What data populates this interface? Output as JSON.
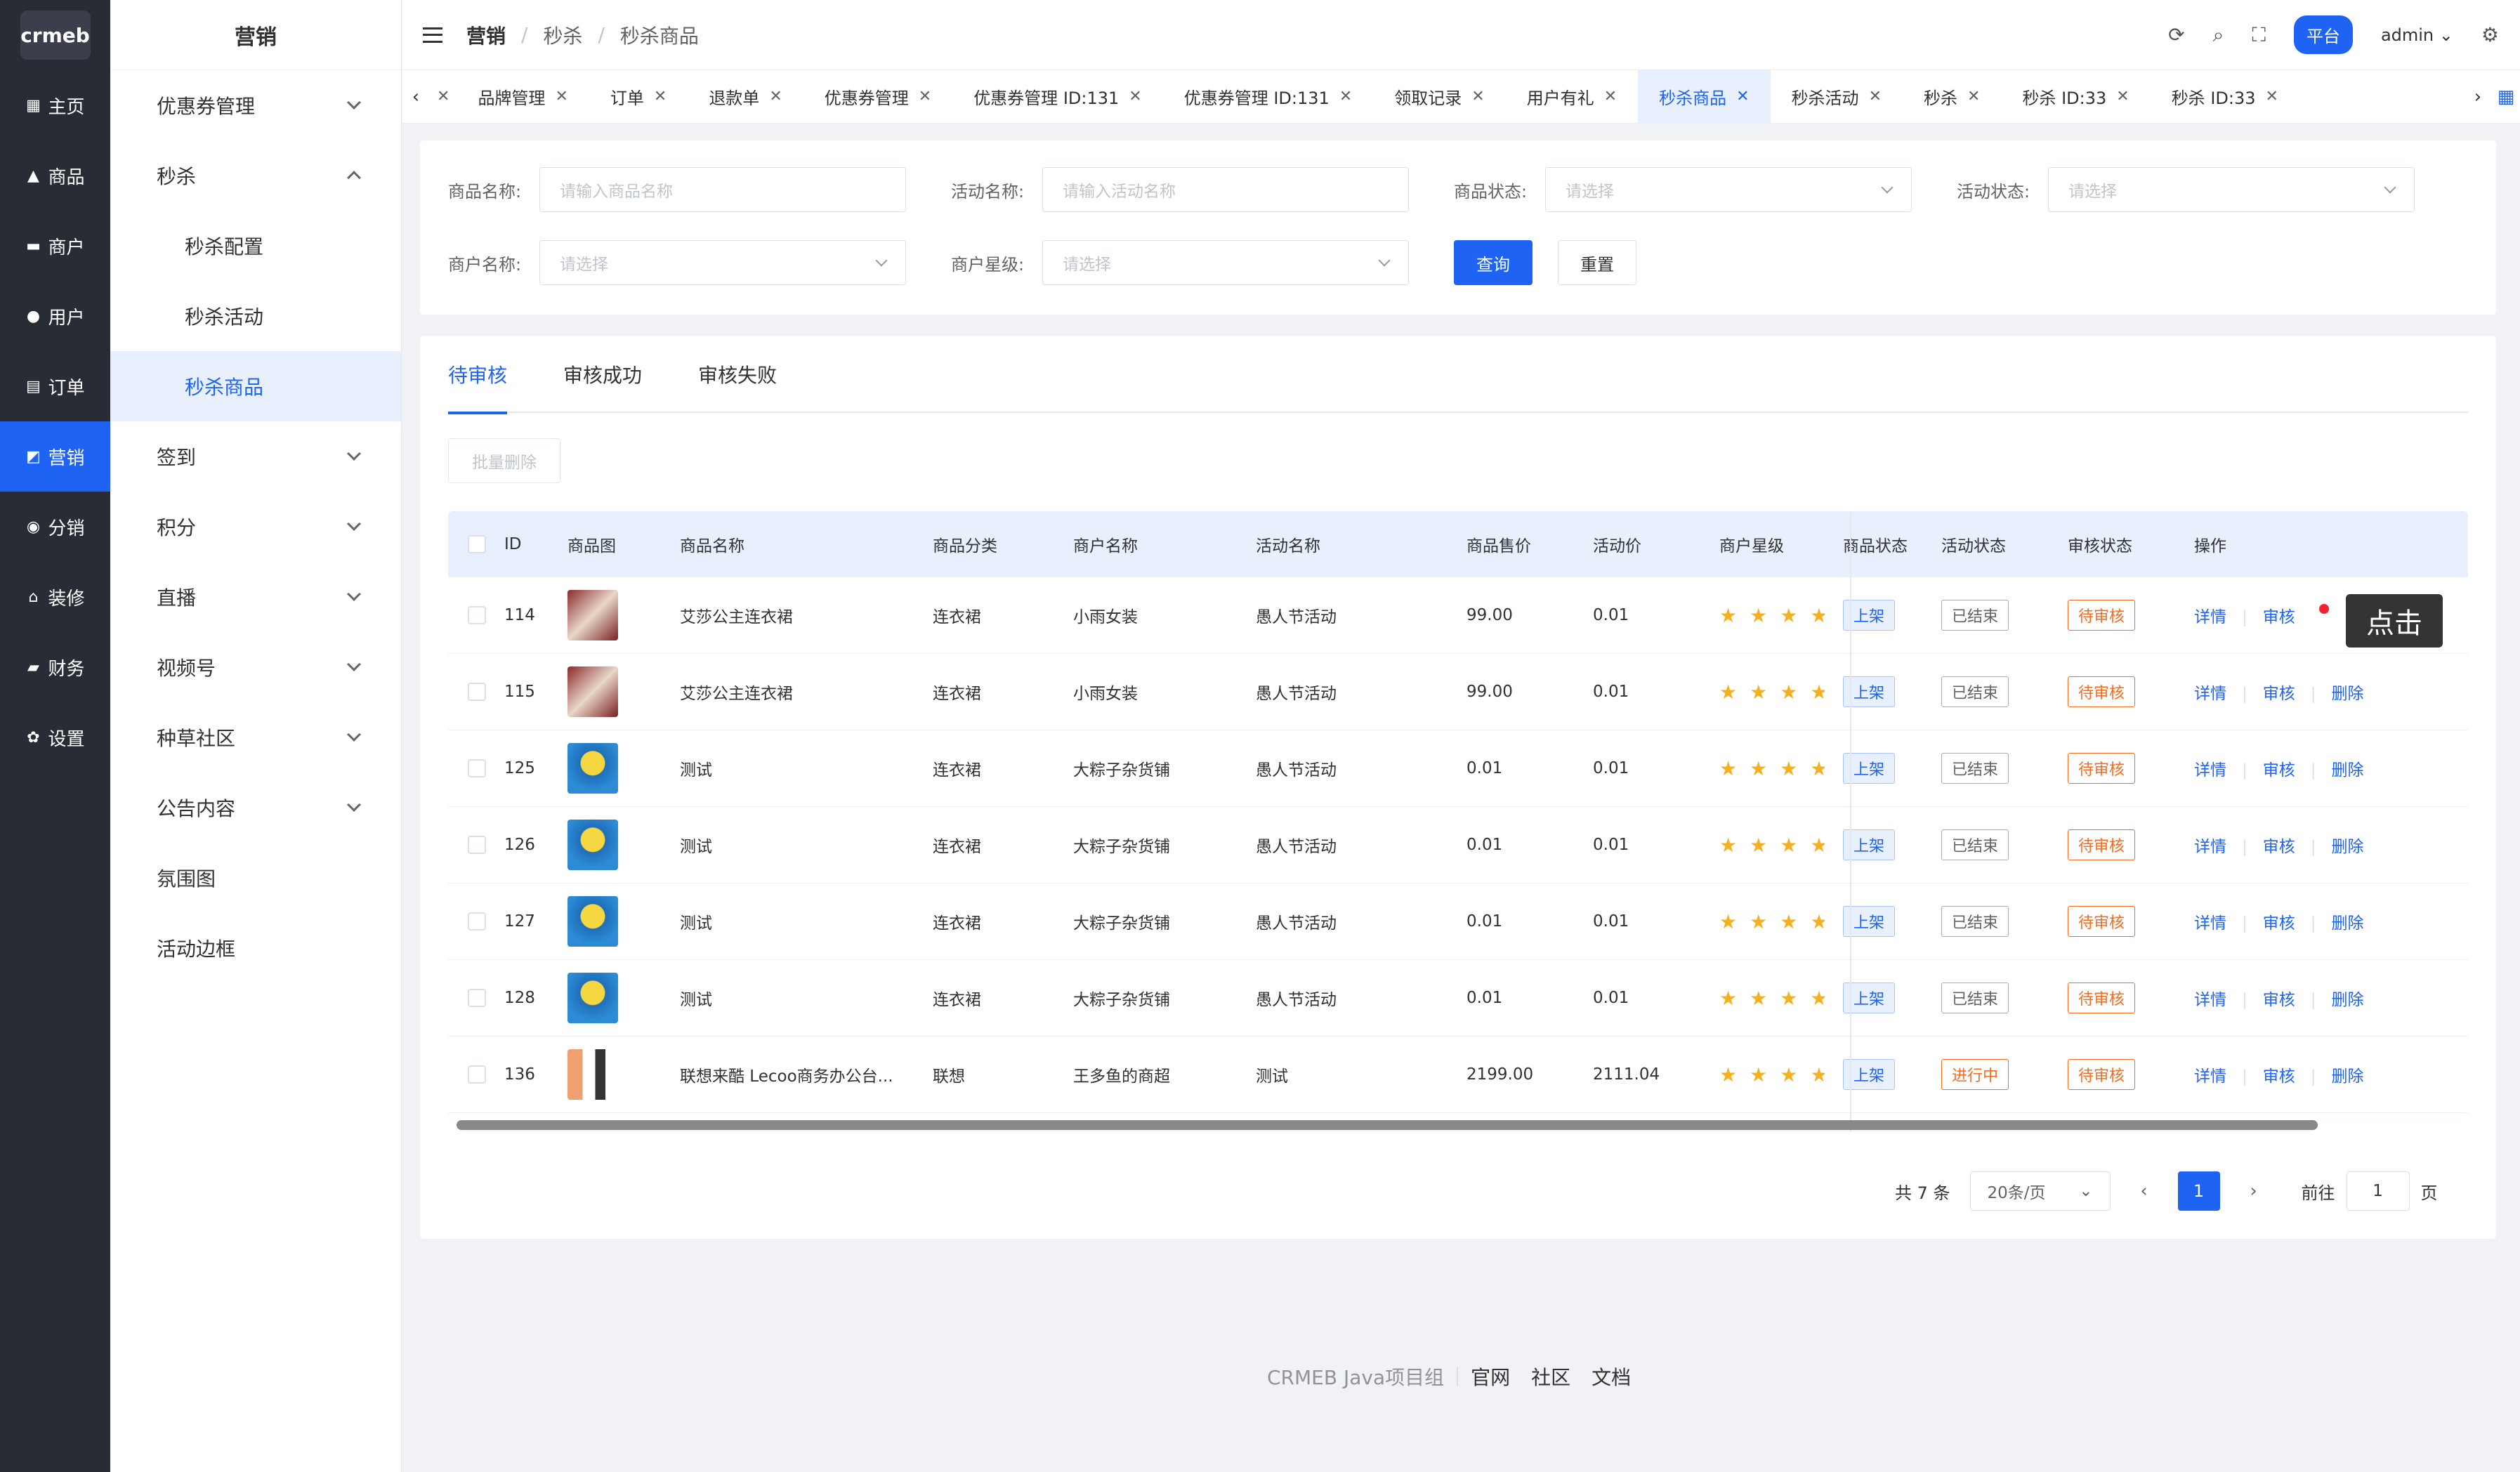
{
  "logo": "crmeb",
  "rail": [
    {
      "label": "主页",
      "icon": "grid-icon"
    },
    {
      "label": "商品",
      "icon": "bag-icon"
    },
    {
      "label": "商户",
      "icon": "store-icon"
    },
    {
      "label": "用户",
      "icon": "user-icon"
    },
    {
      "label": "订单",
      "icon": "order-icon"
    },
    {
      "label": "营销",
      "icon": "marketing-icon"
    },
    {
      "label": "分销",
      "icon": "distribution-icon"
    },
    {
      "label": "装修",
      "icon": "home-icon"
    },
    {
      "label": "财务",
      "icon": "wallet-icon"
    },
    {
      "label": "设置",
      "icon": "gear-icon"
    }
  ],
  "submenu": {
    "title": "营销",
    "items": [
      {
        "label": "优惠券管理"
      },
      {
        "label": "秒杀"
      },
      {
        "label": "秒杀配置"
      },
      {
        "label": "秒杀活动"
      },
      {
        "label": "秒杀商品"
      },
      {
        "label": "签到"
      },
      {
        "label": "积分"
      },
      {
        "label": "直播"
      },
      {
        "label": "视频号"
      },
      {
        "label": "种草社区"
      },
      {
        "label": "公告内容"
      },
      {
        "label": "氛围图"
      },
      {
        "label": "活动边框"
      }
    ]
  },
  "header": {
    "crumbs": [
      "营销",
      "秒杀",
      "秒杀商品"
    ],
    "platform": "平台",
    "user": "admin"
  },
  "tabs": [
    "品牌管理",
    "订单",
    "退款单",
    "优惠券管理",
    "优惠券管理 ID:131",
    "优惠券管理 ID:131",
    "领取记录",
    "用户有礼",
    "秒杀商品",
    "秒杀活动",
    "秒杀",
    "秒杀 ID:33",
    "秒杀 ID:33"
  ],
  "filter": {
    "product_name_label": "商品名称:",
    "product_name_ph": "请输入商品名称",
    "activity_name_label": "活动名称:",
    "activity_name_ph": "请输入活动名称",
    "product_status_label": "商品状态:",
    "activity_status_label": "活动状态:",
    "merchant_name_label": "商户名称:",
    "merchant_star_label": "商户星级:",
    "select_ph": "请选择",
    "query": "查询",
    "reset": "重置"
  },
  "page_tabs": [
    "待审核",
    "审核成功",
    "审核失败"
  ],
  "batch_delete": "批量删除",
  "table": {
    "headers": [
      "ID",
      "商品图",
      "商品名称",
      "商品分类",
      "商户名称",
      "活动名称",
      "商品售价",
      "活动价",
      "商户星级",
      "商品状态",
      "活动状态",
      "审核状态",
      "操作"
    ],
    "rows": [
      {
        "id": "114",
        "name": "艾莎公主连衣裙",
        "cat": "连衣裙",
        "merchant": "小雨女装",
        "activity": "愚人节活动",
        "price": "99.00",
        "act_price": "0.01",
        "status": "上架",
        "act_status": "已结束",
        "audit": "待审核",
        "thumb": "a"
      },
      {
        "id": "115",
        "name": "艾莎公主连衣裙",
        "cat": "连衣裙",
        "merchant": "小雨女装",
        "activity": "愚人节活动",
        "price": "99.00",
        "act_price": "0.01",
        "status": "上架",
        "act_status": "已结束",
        "audit": "待审核",
        "thumb": "a"
      },
      {
        "id": "125",
        "name": "测试",
        "cat": "连衣裙",
        "merchant": "大粽子杂货铺",
        "activity": "愚人节活动",
        "price": "0.01",
        "act_price": "0.01",
        "status": "上架",
        "act_status": "已结束",
        "audit": "待审核",
        "thumb": "b"
      },
      {
        "id": "126",
        "name": "测试",
        "cat": "连衣裙",
        "merchant": "大粽子杂货铺",
        "activity": "愚人节活动",
        "price": "0.01",
        "act_price": "0.01",
        "status": "上架",
        "act_status": "已结束",
        "audit": "待审核",
        "thumb": "b"
      },
      {
        "id": "127",
        "name": "测试",
        "cat": "连衣裙",
        "merchant": "大粽子杂货铺",
        "activity": "愚人节活动",
        "price": "0.01",
        "act_price": "0.01",
        "status": "上架",
        "act_status": "已结束",
        "audit": "待审核",
        "thumb": "b"
      },
      {
        "id": "128",
        "name": "测试",
        "cat": "连衣裙",
        "merchant": "大粽子杂货铺",
        "activity": "愚人节活动",
        "price": "0.01",
        "act_price": "0.01",
        "status": "上架",
        "act_status": "已结束",
        "audit": "待审核",
        "thumb": "b"
      },
      {
        "id": "136",
        "name": "联想来酷 Lecoo商务办公台...",
        "cat": "联想",
        "merchant": "王多鱼的商超",
        "activity": "测试",
        "price": "2199.00",
        "act_price": "2111.04",
        "status": "上架",
        "act_status": "进行中",
        "audit": "待审核",
        "thumb": "c2"
      }
    ],
    "ops": [
      "详情",
      "审核",
      "删除"
    ]
  },
  "tooltip": "点击",
  "pager": {
    "total": "共 7 条",
    "size": "20条/页",
    "page": "1",
    "goto": "前往",
    "goto_val": "1",
    "page_unit": "页"
  },
  "footer": {
    "company": "CRMEB Java项目组",
    "links": [
      "官网",
      "社区",
      "文档"
    ]
  }
}
